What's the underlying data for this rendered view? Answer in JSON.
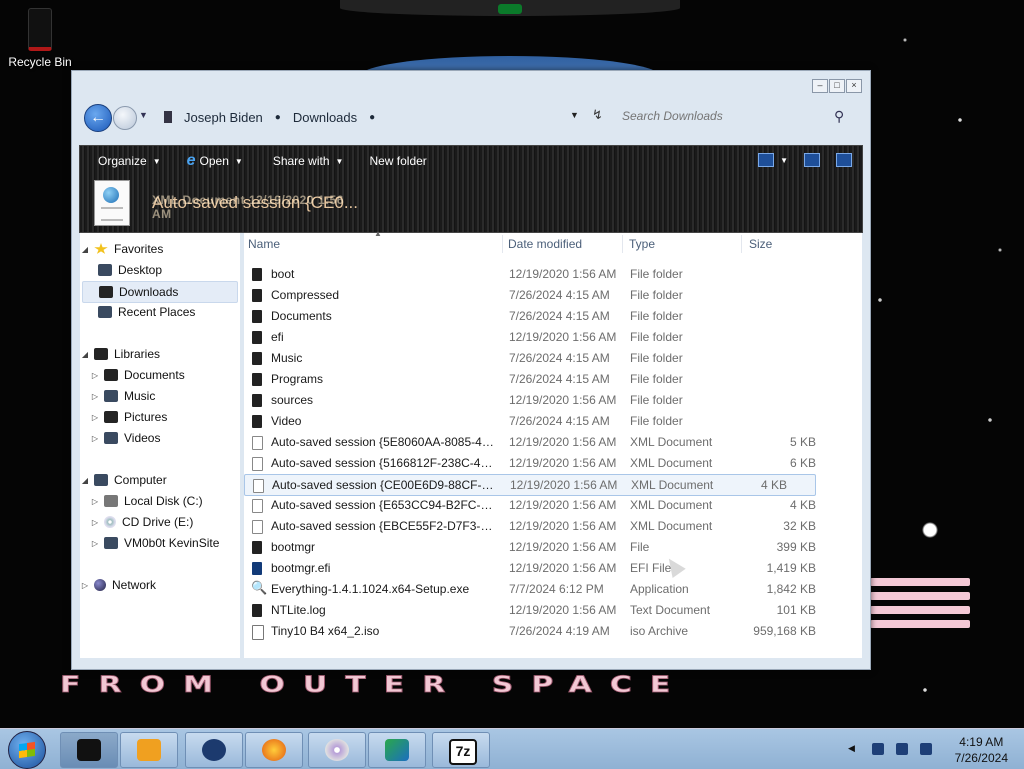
{
  "desktop": {
    "recycle_bin_label": "Recycle Bin",
    "wallpaper_text": "FROM OUTER SPACE"
  },
  "window": {
    "nav": {
      "back_icon": "back-arrow-icon",
      "forward_icon": "forward-arrow-icon"
    },
    "address": {
      "crumbs": [
        "Joseph Biden",
        "Downloads"
      ]
    },
    "search": {
      "placeholder": "Search Downloads"
    },
    "toolbar": {
      "organize": "Organize",
      "open": "Open",
      "share_with": "Share with",
      "new_folder": "New folder"
    },
    "details_pane": {
      "title": "Auto-saved session {CE0...",
      "ghost_text": "XML Document   12/19/2020 1:56 AM"
    },
    "nav_pane": {
      "favorites": "Favorites",
      "desktop": "Desktop",
      "downloads": "Downloads",
      "recent_places": "Recent Places",
      "libraries": "Libraries",
      "documents": "Documents",
      "music": "Music",
      "pictures": "Pictures",
      "videos": "Videos",
      "computer": "Computer",
      "local_disk": "Local Disk (C:)",
      "cd_drive": "CD Drive (E:)",
      "network_share": "VM0b0t KevinSite",
      "network": "Network"
    },
    "columns": {
      "name": "Name",
      "date_modified": "Date modified",
      "type": "Type",
      "size": "Size"
    },
    "files": [
      {
        "name": "boot",
        "date": "12/19/2020 1:56 AM",
        "type": "File folder",
        "size": ""
      },
      {
        "name": "Compressed",
        "date": "7/26/2024 4:15 AM",
        "type": "File folder",
        "size": ""
      },
      {
        "name": "Documents",
        "date": "7/26/2024 4:15 AM",
        "type": "File folder",
        "size": ""
      },
      {
        "name": "efi",
        "date": "12/19/2020 1:56 AM",
        "type": "File folder",
        "size": ""
      },
      {
        "name": "Music",
        "date": "7/26/2024 4:15 AM",
        "type": "File folder",
        "size": ""
      },
      {
        "name": "Programs",
        "date": "7/26/2024 4:15 AM",
        "type": "File folder",
        "size": ""
      },
      {
        "name": "sources",
        "date": "12/19/2020 1:56 AM",
        "type": "File folder",
        "size": ""
      },
      {
        "name": "Video",
        "date": "7/26/2024 4:15 AM",
        "type": "File folder",
        "size": ""
      },
      {
        "name": "Auto-saved session {5E8060AA-8085-4D3...",
        "date": "12/19/2020 1:56 AM",
        "type": "XML Document",
        "size": "5 KB"
      },
      {
        "name": "Auto-saved session {5166812F-238C-4399...",
        "date": "12/19/2020 1:56 AM",
        "type": "XML Document",
        "size": "6 KB"
      },
      {
        "name": "Auto-saved session {CE00E6D9-88CF-482...",
        "date": "12/19/2020 1:56 AM",
        "type": "XML Document",
        "size": "4 KB"
      },
      {
        "name": "Auto-saved session {E653CC94-B2FC-4D...",
        "date": "12/19/2020 1:56 AM",
        "type": "XML Document",
        "size": "4 KB"
      },
      {
        "name": "Auto-saved session {EBCE55F2-D7F3-414...",
        "date": "12/19/2020 1:56 AM",
        "type": "XML Document",
        "size": "32 KB"
      },
      {
        "name": "bootmgr",
        "date": "12/19/2020 1:56 AM",
        "type": "File",
        "size": "399 KB"
      },
      {
        "name": "bootmgr.efi",
        "date": "12/19/2020 1:56 AM",
        "type": "EFI File",
        "size": "1,419 KB"
      },
      {
        "name": "Everything-1.4.1.1024.x64-Setup.exe",
        "date": "7/7/2024 6:12 PM",
        "type": "Application",
        "size": "1,842 KB"
      },
      {
        "name": "NTLite.log",
        "date": "12/19/2020 1:56 AM",
        "type": "Text Document",
        "size": "101 KB"
      },
      {
        "name": "Tiny10 B4 x64_2.iso",
        "date": "7/26/2024 4:19 AM",
        "type": "iso Archive",
        "size": "959,168 KB"
      }
    ]
  },
  "taskbar": {
    "apps": [
      "explorer",
      "media-player",
      "browser",
      "firefox",
      "disc-burner",
      "download-manager",
      "7zip"
    ],
    "seven_zip_label": "7z",
    "clock": {
      "time": "4:19 AM",
      "date": "7/26/2024"
    }
  }
}
